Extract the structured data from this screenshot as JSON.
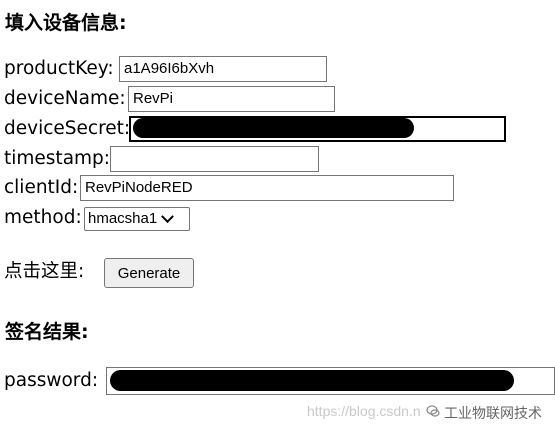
{
  "section1": {
    "heading": "填入设备信息:"
  },
  "fields": {
    "productKey": {
      "label": "productKey:",
      "value": "a1A96I6bXvh"
    },
    "deviceName": {
      "label": "deviceName:",
      "value": "RevPi"
    },
    "deviceSecret": {
      "label": "deviceSecret:",
      "value": ""
    },
    "timestamp": {
      "label": "timestamp:",
      "value": ""
    },
    "clientId": {
      "label": "clientId:",
      "value": "RevPiNodeRED"
    },
    "method": {
      "label": "method:",
      "selected": "hmacsha1"
    }
  },
  "action": {
    "prompt": "点击这里:",
    "button_label": "Generate"
  },
  "section2": {
    "heading": "签名结果:"
  },
  "result": {
    "label": "password:",
    "value": ""
  },
  "watermark": {
    "url": "https://blog.csdn.n",
    "account": "工业物联网技术"
  }
}
